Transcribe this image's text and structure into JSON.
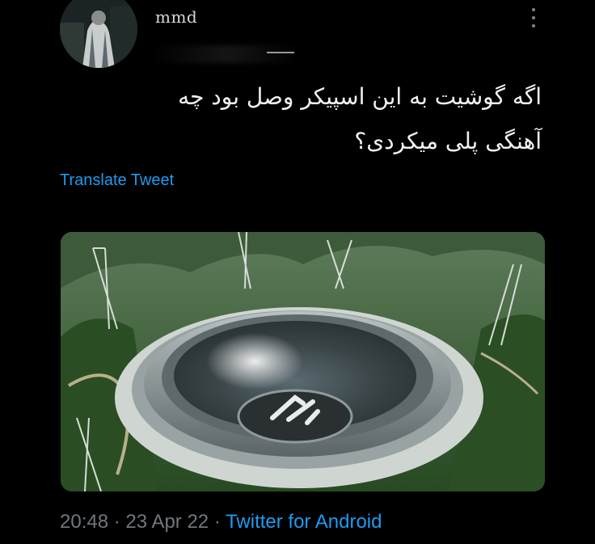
{
  "tweet": {
    "author": {
      "display_name": "mmd",
      "handle_dash": "_"
    },
    "text_line1": "اگه گوشیت به این اسپیکر وصل بود چه",
    "text_line2": "آهنگی پلی میکردی؟",
    "translate_label": "Translate Tweet",
    "time": "20:48",
    "date": "23 Apr 22",
    "source": "Twitter for Android",
    "separator": "·",
    "media": {
      "subject": "giant speaker subwoofer in radio telescope dish",
      "colors": {
        "forest": "#2f5a2c",
        "metal": "#7f8a8c",
        "cone": "#3e4a4e"
      }
    }
  }
}
